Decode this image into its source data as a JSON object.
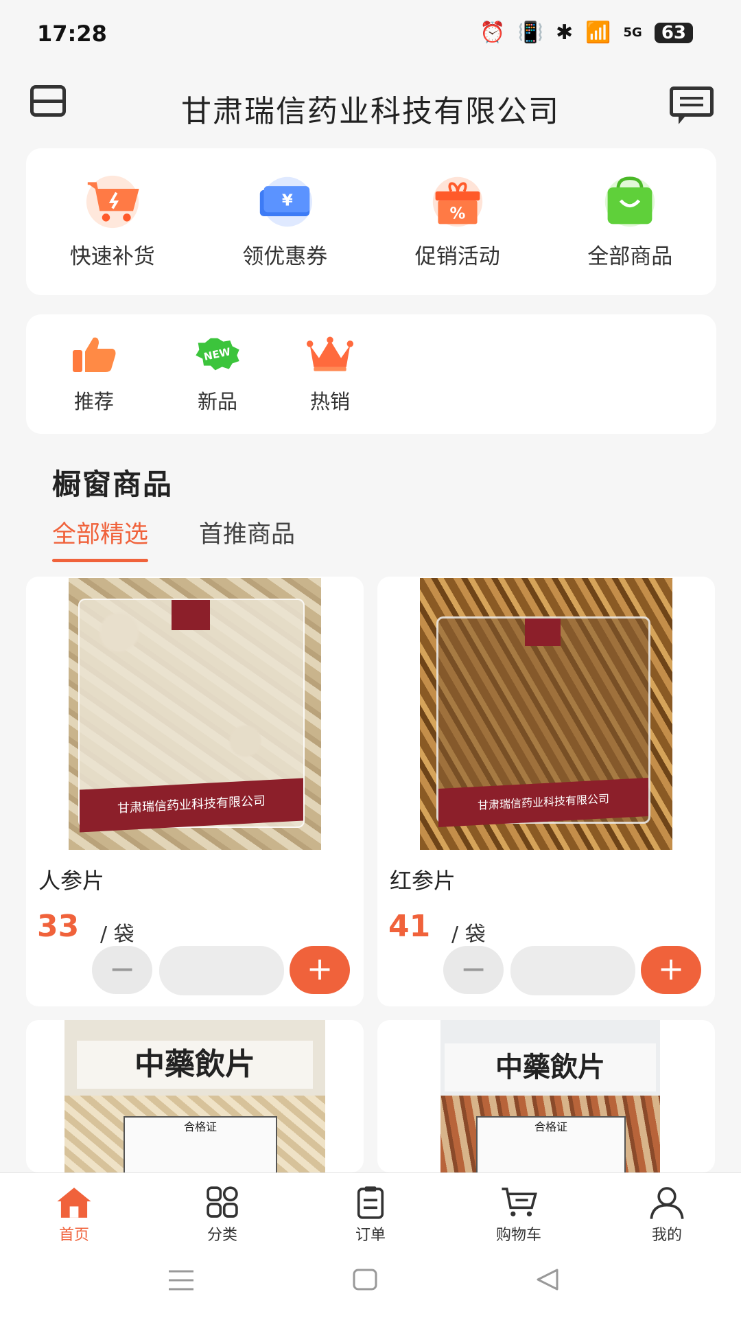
{
  "status_bar": {
    "time": "17:28",
    "network": "5G",
    "battery": "63"
  },
  "header": {
    "title": "甘肃瑞信药业科技有限公司"
  },
  "quick_nav": [
    {
      "label": "快速补货",
      "icon": "cart-bolt-icon",
      "color": "#ff7a45"
    },
    {
      "label": "领优惠券",
      "icon": "coupon-icon",
      "color": "#3d7bf5"
    },
    {
      "label": "促销活动",
      "icon": "gift-percent-icon",
      "color": "#ff6a3d"
    },
    {
      "label": "全部商品",
      "icon": "shopping-bag-icon",
      "color": "#5fd03a"
    }
  ],
  "secondary_nav": [
    {
      "label": "推荐",
      "icon": "thumbs-up-icon"
    },
    {
      "label": "新品",
      "icon": "new-badge-icon",
      "badge": "NEW"
    },
    {
      "label": "热销",
      "icon": "crown-icon"
    }
  ],
  "section": {
    "title": "橱窗商品",
    "tabs": [
      {
        "label": "全部精选",
        "active": true
      },
      {
        "label": "首推商品",
        "active": false
      }
    ]
  },
  "products": [
    {
      "name": "人参片",
      "price": "33",
      "unit": "/ 袋",
      "package_text": "甘肃瑞信药业科技有限公司"
    },
    {
      "name": "红参片",
      "price": "41",
      "unit": "/ 袋",
      "package_text": "甘肃瑞信药业科技有限公司"
    },
    {
      "package_text": "中藥飲片",
      "label_text": "合格证"
    },
    {
      "package_text": "中藥飲片",
      "label_text": "合格证"
    }
  ],
  "bottom_nav": [
    {
      "label": "首页",
      "icon": "home-icon",
      "active": true
    },
    {
      "label": "分类",
      "icon": "category-grid-icon",
      "active": false
    },
    {
      "label": "订单",
      "icon": "order-list-icon",
      "active": false
    },
    {
      "label": "购物车",
      "icon": "cart-icon",
      "active": false
    },
    {
      "label": "我的",
      "icon": "user-icon",
      "active": false
    }
  ],
  "colors": {
    "accent": "#f0623b",
    "background": "#f6f6f6"
  }
}
